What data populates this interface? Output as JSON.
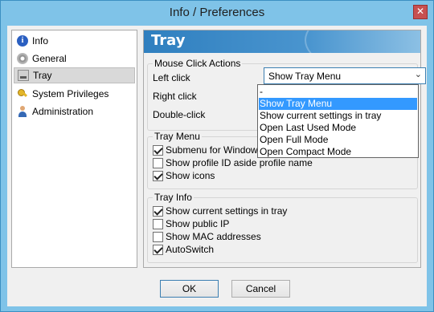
{
  "window": {
    "title": "Info / Preferences",
    "close_glyph": "✕"
  },
  "nav": {
    "items": [
      {
        "label": "Info",
        "icon": "info-icon"
      },
      {
        "label": "General",
        "icon": "gear-icon"
      },
      {
        "label": "Tray",
        "icon": "tray-icon",
        "selected": true
      },
      {
        "label": "System Privileges",
        "icon": "keys-icon"
      },
      {
        "label": "Administration",
        "icon": "user-icon"
      }
    ]
  },
  "content": {
    "header": "Tray",
    "mouse_actions": {
      "title": "Mouse Click Actions",
      "left_click_label": "Left click",
      "left_click_value": "Show Tray Menu",
      "right_click_label": "Right click",
      "double_click_label": "Double-click"
    },
    "dropdown_options": [
      "-",
      "Show Tray Menu",
      "Show current settings in tray",
      "Open Last Used Mode",
      "Open Full Mode",
      "Open Compact Mode"
    ],
    "tray_menu": {
      "title": "Tray Menu",
      "options": [
        {
          "label": "Submenu for Windows location",
          "checked": true
        },
        {
          "label": "Show profile ID aside profile name",
          "checked": false
        },
        {
          "label": "Show icons",
          "checked": true
        }
      ]
    },
    "tray_info": {
      "title": "Tray Info",
      "options": [
        {
          "label": "Show current settings in tray",
          "checked": true
        },
        {
          "label": "Show public IP",
          "checked": false
        },
        {
          "label": "Show MAC addresses",
          "checked": false
        },
        {
          "label": "AutoSwitch",
          "checked": true
        }
      ]
    }
  },
  "buttons": {
    "ok": "OK",
    "cancel": "Cancel"
  }
}
